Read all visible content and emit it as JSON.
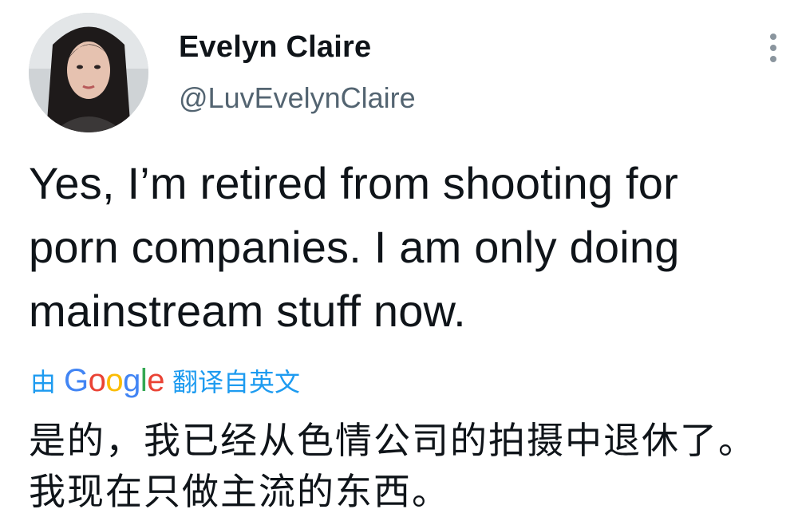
{
  "author": {
    "display_name": "Evelyn Claire",
    "handle": "@LuvEvelynClaire"
  },
  "menu_icon": "more-vertical-icon",
  "tweet": {
    "text": "Yes, I’m retired from shooting for porn companies. I am only doing mainstream stuff now."
  },
  "translation": {
    "prefix": "由",
    "provider_letters": [
      "G",
      "o",
      "o",
      "g",
      "l",
      "e"
    ],
    "suffix": "翻译自英文",
    "text": "是的，我已经从色情公司的拍摄中退休了。我现在只做主流的东西。"
  },
  "colors": {
    "link_blue": "#1d9bf0",
    "secondary_text": "#536471",
    "primary_text": "#0f1419"
  }
}
